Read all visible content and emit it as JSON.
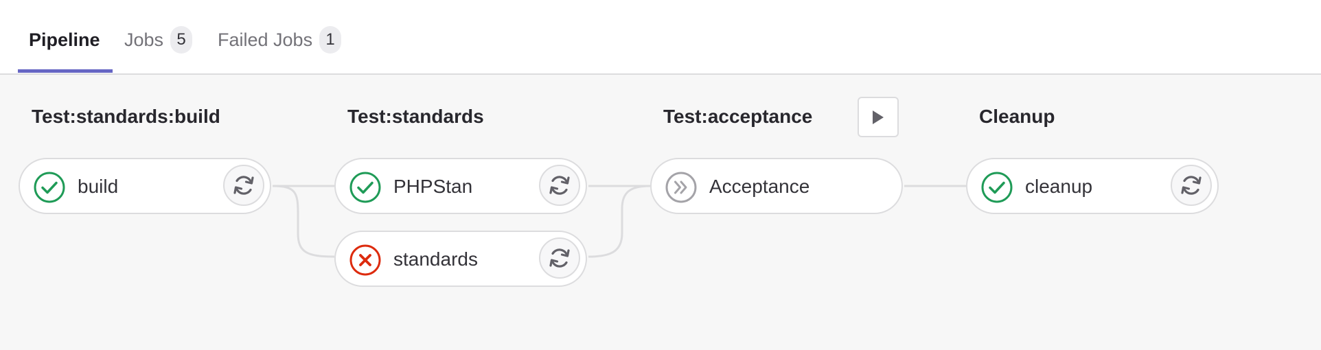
{
  "tabs": [
    {
      "label": "Pipeline",
      "active": true
    },
    {
      "label": "Jobs",
      "count": "5"
    },
    {
      "label": "Failed Jobs",
      "count": "1"
    }
  ],
  "stages": [
    {
      "title": "Test:standards:build",
      "jobs": [
        {
          "name": "build",
          "status": "success",
          "action": "retry-icon"
        }
      ]
    },
    {
      "title": "Test:standards",
      "jobs": [
        {
          "name": "PHPStan",
          "status": "success",
          "action": "retry-icon"
        },
        {
          "name": "standards",
          "status": "failed",
          "action": "retry-icon"
        }
      ]
    },
    {
      "title": "Test:acceptance",
      "stage_action": "play-icon",
      "jobs": [
        {
          "name": "Acceptance",
          "status": "skipped"
        }
      ]
    },
    {
      "title": "Cleanup",
      "jobs": [
        {
          "name": "cleanup",
          "status": "success",
          "action": "retry-icon"
        }
      ]
    }
  ],
  "colors": {
    "success": "#1f9b57",
    "failed": "#dd2b0e",
    "skipped": "#a4a3a8",
    "tab_accent": "#6666c4"
  }
}
